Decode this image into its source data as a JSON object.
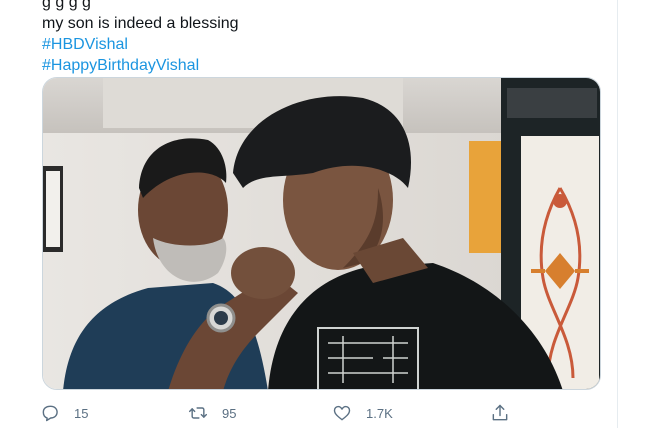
{
  "tweet": {
    "clipped_line": "g   g   g   g",
    "text_line": "my son is indeed a blessing",
    "hashtags": [
      "#HBDVishal",
      "#HappyBirthdayVishal"
    ]
  },
  "actions": {
    "reply": {
      "icon": "reply-icon",
      "count": "15"
    },
    "retweet": {
      "icon": "retweet-icon",
      "count": "95"
    },
    "like": {
      "icon": "heart-icon",
      "count": "1.7K"
    },
    "share": {
      "icon": "share-icon"
    }
  },
  "colors": {
    "link": "#1b95e0",
    "action": "#5b7083",
    "divider": "#e6ecf0"
  }
}
